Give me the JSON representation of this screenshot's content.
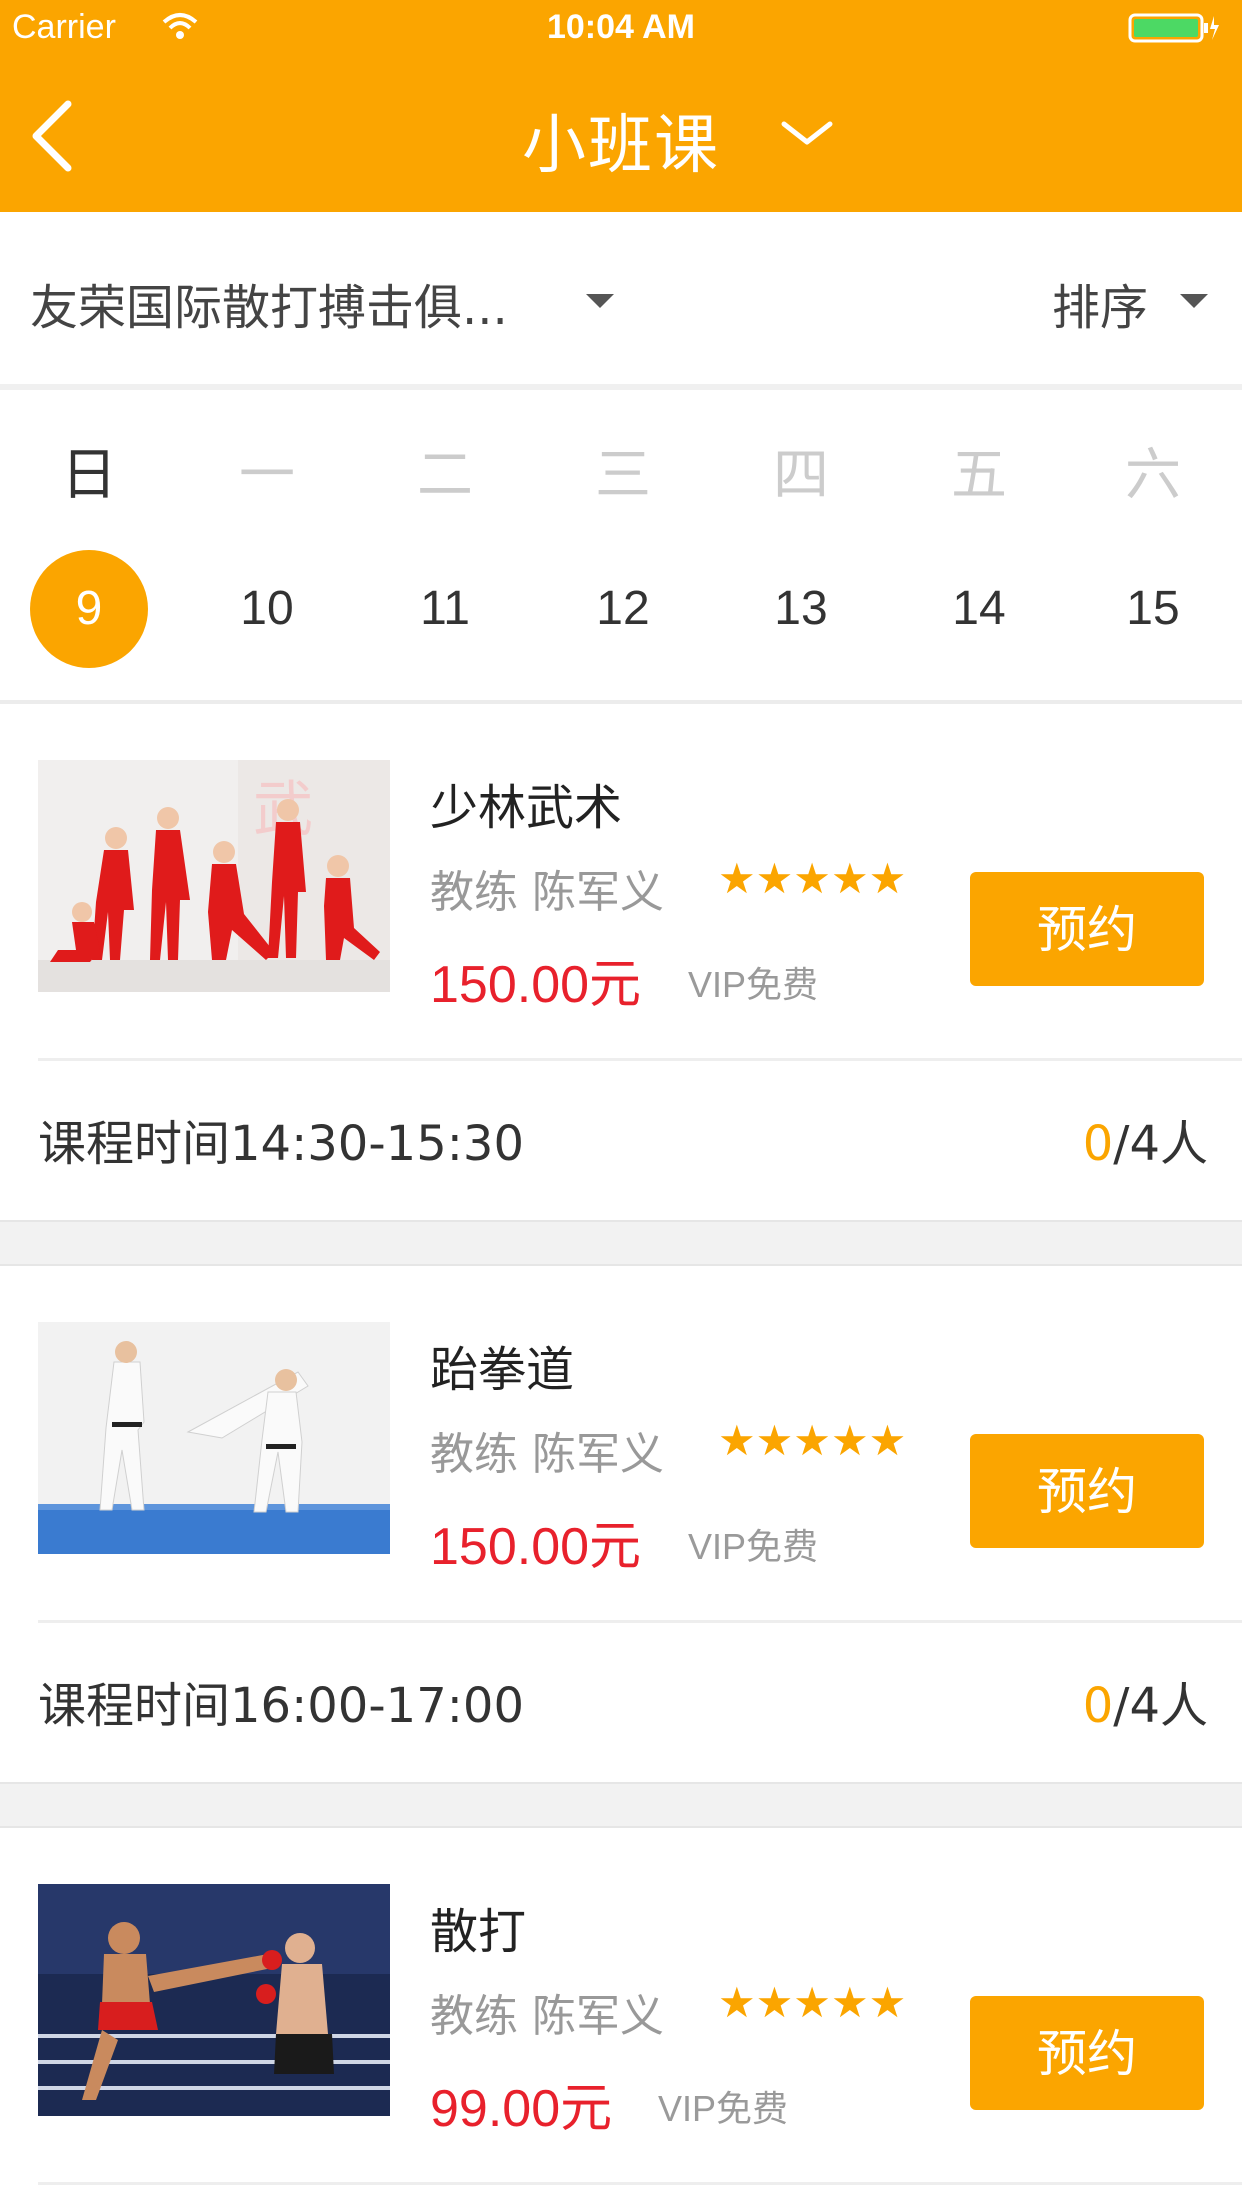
{
  "status_bar": {
    "carrier": "Carrier",
    "time": "10:04 AM"
  },
  "nav": {
    "title": "小班课",
    "back_icon": "chevron-left-icon",
    "title_dropdown_icon": "chevron-down-icon"
  },
  "filter": {
    "club": "友荣国际散打搏击俱...",
    "sort": "排序"
  },
  "week": {
    "selected_index": 0,
    "days": [
      {
        "weekday": "日",
        "date": "9"
      },
      {
        "weekday": "一",
        "date": "10"
      },
      {
        "weekday": "二",
        "date": "11"
      },
      {
        "weekday": "三",
        "date": "12"
      },
      {
        "weekday": "四",
        "date": "13"
      },
      {
        "weekday": "五",
        "date": "14"
      },
      {
        "weekday": "六",
        "date": "15"
      }
    ]
  },
  "courses": [
    {
      "name": "少林武术",
      "coach": "教练 陈军义",
      "rating": 5,
      "stars": "★★★★★",
      "price": "150.00元",
      "vip": "VIP免费",
      "book_label": "预约",
      "time_label": "课程时间14:30-15:30",
      "booked": "0",
      "capacity": "/4人"
    },
    {
      "name": "跆拳道",
      "coach": "教练 陈军义",
      "rating": 5,
      "stars": "★★★★★",
      "price": "150.00元",
      "vip": "VIP免费",
      "book_label": "预约",
      "time_label": "课程时间16:00-17:00",
      "booked": "0",
      "capacity": "/4人"
    },
    {
      "name": "散打",
      "coach": "教练 陈军义",
      "rating": 5,
      "stars": "★★★★★",
      "price": "99.00元",
      "vip": "VIP免费",
      "book_label": "预约"
    }
  ],
  "colors": {
    "accent": "#fba500",
    "price": "#e8212c"
  }
}
